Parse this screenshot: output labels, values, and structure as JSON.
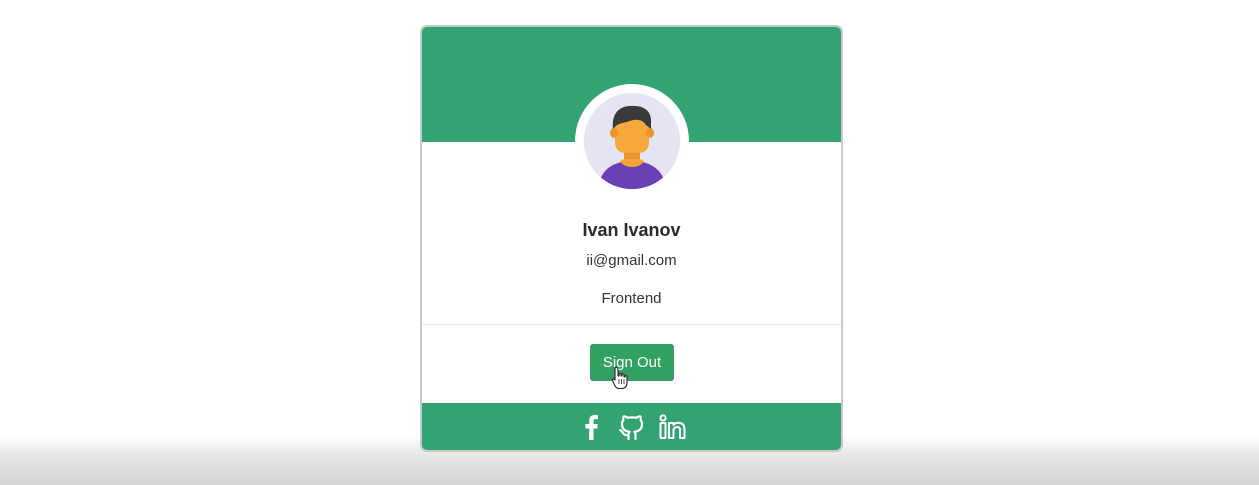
{
  "colors": {
    "brand": "#33a373",
    "button": "#33a164",
    "avatar_bg": "#e6e3f3"
  },
  "profile": {
    "name": "Ivan Ivanov",
    "email": "ii@gmail.com",
    "role": "Frontend"
  },
  "actions": {
    "signout_label": "Sign Out"
  },
  "social": [
    {
      "icon": "facebook-icon"
    },
    {
      "icon": "github-icon"
    },
    {
      "icon": "linkedin-icon"
    }
  ]
}
